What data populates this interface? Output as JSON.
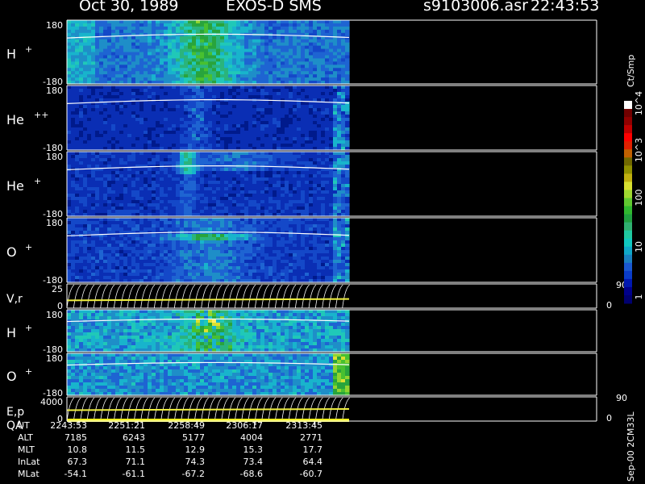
{
  "header": {
    "date_title": "Oct 30, 1989",
    "mission": "EXOS-D SMS",
    "file": "s9103006.asr",
    "time": "22:43:53"
  },
  "chart_data": {
    "type": "heatmap",
    "panels": [
      {
        "label": "H+",
        "species": "H",
        "charge": "+",
        "ymin": "-180",
        "ymax": "180"
      },
      {
        "label": "He++",
        "species": "He",
        "charge": "++",
        "ymin": "-180",
        "ymax": "180"
      },
      {
        "label": "He+",
        "species": "He",
        "charge": "+",
        "ymin": "-180",
        "ymax": "180"
      },
      {
        "label": "O+",
        "species": "O",
        "charge": "+",
        "ymin": "-180",
        "ymax": "180"
      },
      {
        "label": "V,r",
        "ymin": "0",
        "ymax": "25",
        "right_top": "90",
        "right_bottom": "0"
      },
      {
        "label": "H+",
        "species": "H",
        "charge": "+",
        "ymin": "-180",
        "ymax": "180"
      },
      {
        "label": "O+",
        "species": "O",
        "charge": "+",
        "ymin": "-180",
        "ymax": "180"
      },
      {
        "label": "E,p",
        "label2": "QA",
        "ymin": "0",
        "ymax": "4000",
        "right_top": "90",
        "right_bottom": "0"
      }
    ],
    "colorbar": {
      "unit": "Ct/Smp",
      "ticks": [
        "1",
        "10",
        "100",
        "10^3",
        "10^4"
      ],
      "colors": [
        "#000070",
        "#00008b",
        "#0018b0",
        "#0a3cc8",
        "#1a58d0",
        "#1a80c0",
        "#10a8c8",
        "#10c8c0",
        "#20c8a0",
        "#30b070",
        "#20a040",
        "#30b830",
        "#60c830",
        "#a0d830",
        "#d8e030",
        "#c0b010",
        "#909000",
        "#706800",
        "#c06000",
        "#e02000",
        "#ff0000",
        "#c00000",
        "#900000",
        "#700000",
        "#ffffff"
      ]
    },
    "ephemeris": {
      "labels": [
        "UT",
        "ALT",
        "MLT",
        "InLat",
        "MLat"
      ],
      "columns": [
        [
          "2243:53",
          "7185",
          "10.8",
          "67.3",
          "-54.1"
        ],
        [
          "2251:21",
          "6243",
          "11.5",
          "71.1",
          "-61.1"
        ],
        [
          "2258:49",
          "5177",
          "12.9",
          "74.3",
          "-67.2"
        ],
        [
          "2306:17",
          "4004",
          "15.3",
          "73.4",
          "-68.6"
        ],
        [
          "2313:45",
          "2771",
          "17.7",
          "64.4",
          "-60.7"
        ]
      ]
    },
    "version_label": "Sep-00 2CM33L"
  }
}
